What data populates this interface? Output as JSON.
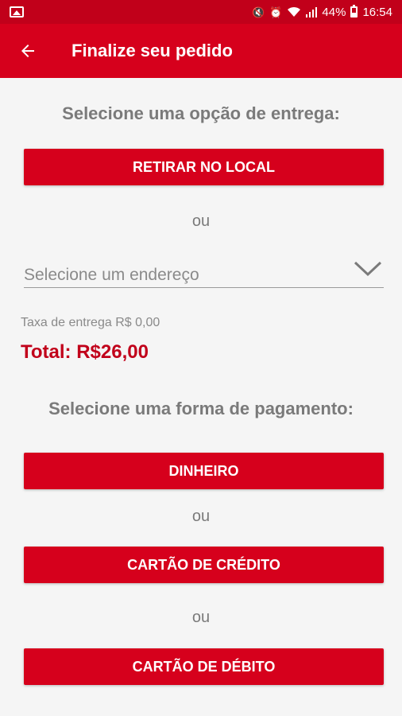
{
  "status_bar": {
    "battery": "44%",
    "time": "16:54",
    "icons": [
      "image-icon",
      "mute-icon",
      "alarm-icon",
      "wifi-icon",
      "signal-icon",
      "battery-icon"
    ]
  },
  "header": {
    "back_icon": "arrow-left-icon",
    "title": "Finalize seu pedido"
  },
  "delivery": {
    "title": "Selecione uma opção de entrega:",
    "pickup_button": "RETIRAR NO LOCAL",
    "or_label": "ou",
    "address_placeholder": "Selecione um endereço",
    "dropdown_icon": "chevron-down-icon",
    "fee_label": "Taxa de entrega R$ 0,00",
    "total_label": "Total: R$26,00"
  },
  "payment": {
    "title": "Selecione uma forma de pagamento:",
    "cash_button": "DINHEIRO",
    "or_label_1": "ou",
    "credit_button": "CARTÃO DE CRÉDITO",
    "or_label_2": "ou",
    "debit_button": "CARTÃO DE DÉBITO"
  },
  "colors": {
    "primary": "#d6001c",
    "status_bar": "#c1001a",
    "total_text": "#c1001a",
    "muted_text": "#7a7a7a"
  }
}
